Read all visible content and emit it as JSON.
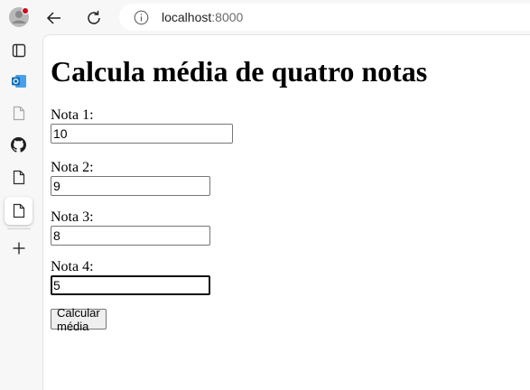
{
  "browser": {
    "address": "localhost",
    "port": ":8000"
  },
  "page": {
    "title": "Calcula média de quatro notas",
    "fields": [
      {
        "label": "Nota 1:",
        "value": "10"
      },
      {
        "label": "Nota 2:",
        "value": "9"
      },
      {
        "label": "Nota 3:",
        "value": "8"
      },
      {
        "label": "Nota 4:",
        "value": "5"
      }
    ],
    "button_label": "Calcular média"
  },
  "sidebar": {
    "items": [
      "profile-avatar",
      "tab-actions",
      "outlook-tab",
      "page-tab",
      "github-tab",
      "page-tab-2",
      "page-tab-active",
      "new-tab"
    ]
  },
  "colors": {
    "notification_dot": "#d0021b",
    "page_background": "#ffffff",
    "chrome_background": "#f7f7f7"
  }
}
